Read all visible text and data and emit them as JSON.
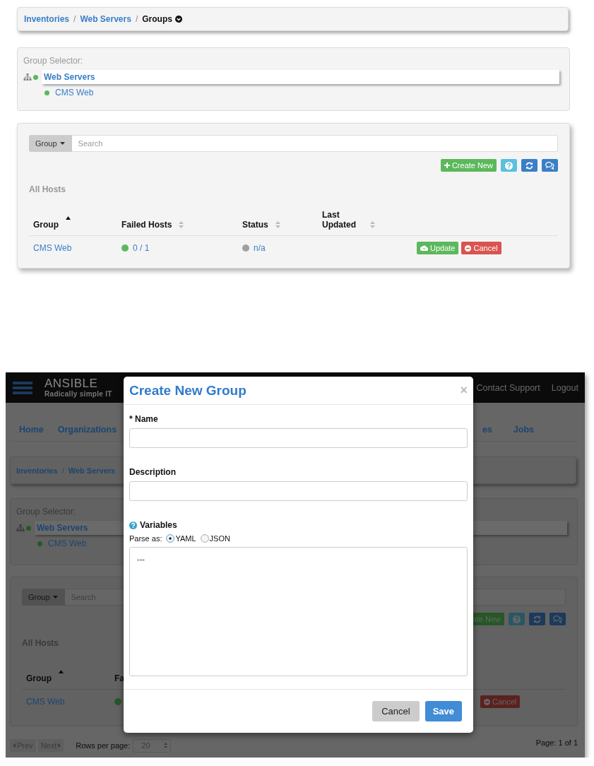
{
  "top_view": {
    "breadcrumbs": [
      {
        "label": "Inventories",
        "separator": "/",
        "current": false
      },
      {
        "label": "Web Servers",
        "separator": "/",
        "current": false
      },
      {
        "label": "Groups",
        "current": true
      }
    ],
    "group_selector": {
      "title": "Group Selector:",
      "tree": [
        {
          "label": "Web Servers",
          "selected": true,
          "color": "#5cb85c",
          "children": [
            {
              "label": "CMS Web",
              "selected": false,
              "color": "#5cb85c"
            }
          ]
        }
      ]
    },
    "hosts_panel": {
      "search": {
        "filter_button": "Group",
        "placeholder": "Search"
      },
      "create_button": "Create New",
      "section_title": "All Hosts",
      "table": {
        "columns": [
          {
            "label": "Group",
            "sorted": true
          },
          {
            "label": "Failed Hosts",
            "sorted": false
          },
          {
            "label": "Status",
            "sorted": false
          },
          {
            "label": "Last Updated",
            "sorted": false
          }
        ],
        "rows": [
          {
            "group": "CMS Web",
            "failed_hosts": {
              "label": "0 / 1",
              "color": "#5cb85c"
            },
            "status": {
              "label": "n/a",
              "color": "#a0a0a0"
            },
            "update": "Update",
            "cancel": "Cancel"
          }
        ]
      }
    }
  },
  "bottom_view": {
    "header": {
      "logo": "ANSIBLE",
      "tagline": "Radically simple IT",
      "links": [
        "Contact Support",
        "Logout"
      ]
    },
    "nav": {
      "left": [
        "Home",
        "Organizations"
      ],
      "right": [
        "es",
        "Jobs"
      ]
    },
    "breadcrumbs": [
      {
        "label": "Inventories",
        "separator": "/",
        "current": false
      },
      {
        "label": "Web Servers",
        "current": false
      }
    ],
    "group_selector": {
      "title": "Group Selector:",
      "tree": [
        {
          "label": "Web Servers",
          "selected": true,
          "color": "#265726",
          "children": [
            {
              "label": "CMS Web",
              "selected": false,
              "color": "#265726"
            }
          ]
        }
      ]
    },
    "hosts_panel": {
      "search": {
        "filter_button": "Group",
        "placeholder": "Search"
      },
      "create_button": "ate New",
      "section_title": "All Hosts",
      "table": {
        "columns": [
          {
            "label": "Group",
            "sorted": true
          },
          {
            "label": "Fa"
          }
        ],
        "rows": [
          {
            "group": "CMS Web",
            "failed_hosts": {
              "color": "#265726"
            },
            "cancel": "Cancel"
          }
        ]
      }
    },
    "pager": {
      "prev": "Prev",
      "next": "Next",
      "rows_label": "Rows per page:",
      "rows_value": "20",
      "page_info": "Page: 1 of 1"
    },
    "modal": {
      "title": "Create New Group",
      "close": "×",
      "fields": [
        {
          "kind": "input",
          "label": "* Name"
        },
        {
          "kind": "input",
          "label": "Description"
        },
        {
          "kind": "editor",
          "label": "Variables",
          "parse_label": "Parse as:",
          "options": [
            {
              "label": "YAML",
              "selected": true
            },
            {
              "label": "JSON",
              "selected": false
            }
          ],
          "value": "---"
        }
      ],
      "buttons": [
        {
          "kind": "default",
          "label": "Cancel"
        },
        {
          "kind": "primary",
          "label": "Save"
        }
      ]
    }
  }
}
